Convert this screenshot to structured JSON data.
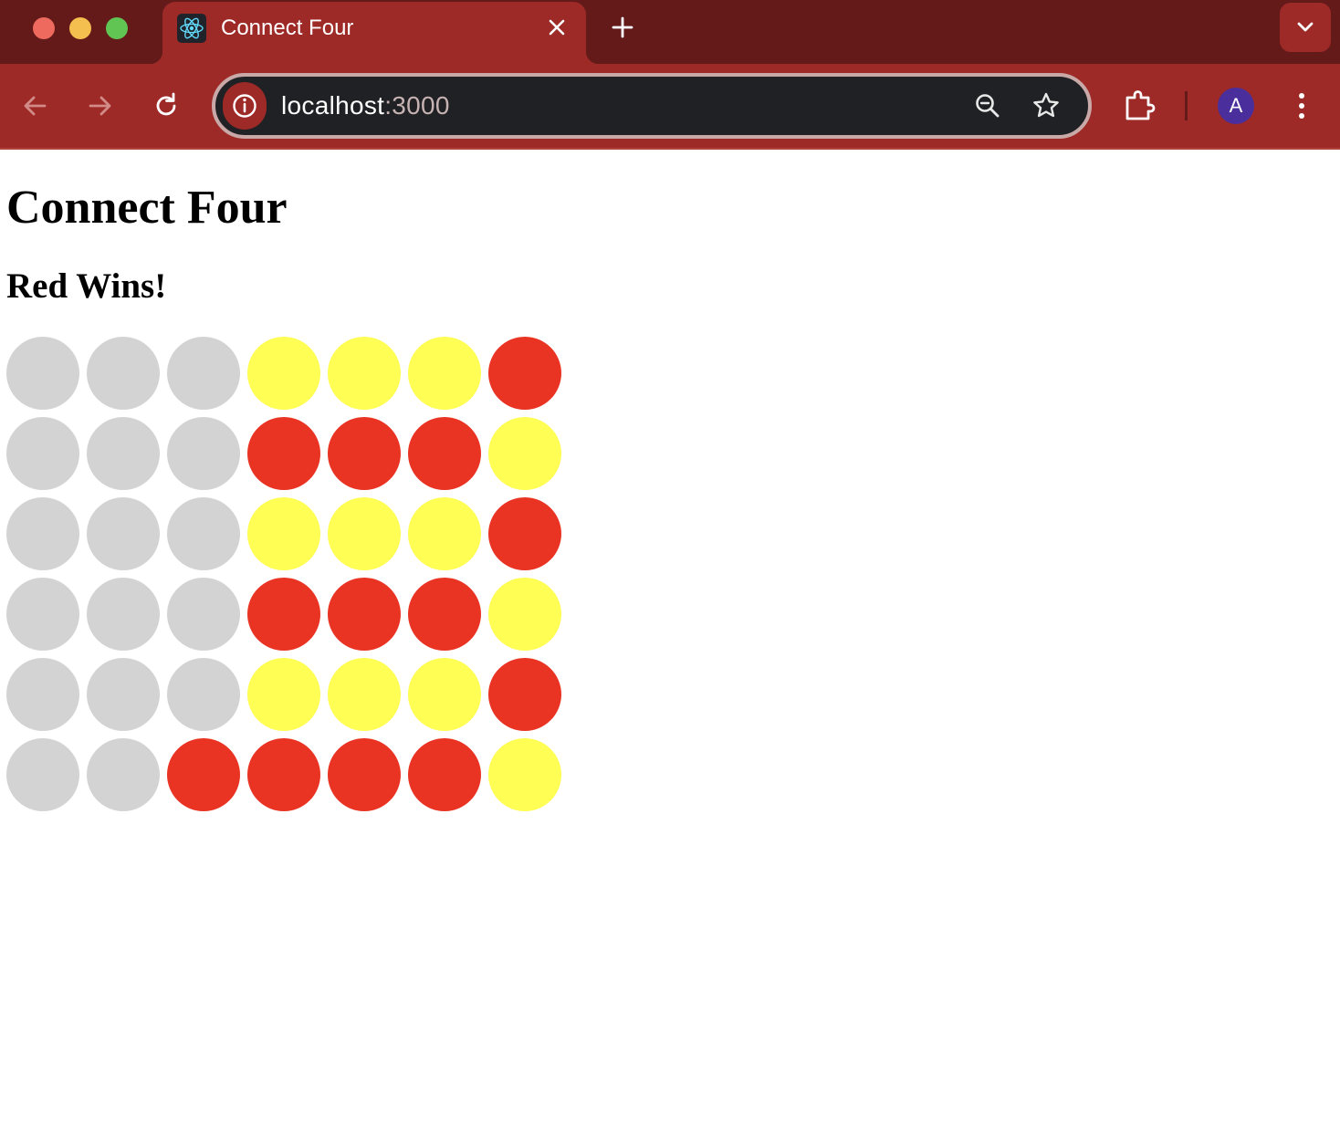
{
  "browser": {
    "tab": {
      "title": "Connect Four",
      "favicon": "react-logo-icon"
    },
    "url": {
      "host": "localhost",
      "port": ":3000"
    },
    "profile_initial": "A",
    "colors": {
      "tabstrip": "#651a1a",
      "toolbar": "#9d2a27",
      "omnibox": "#202124"
    }
  },
  "page": {
    "title": "Connect Four",
    "status": "Red Wins!"
  },
  "game": {
    "colors": {
      "empty": "#d3d3d3",
      "red": "#e93424",
      "yellow": "#fefe54"
    },
    "board": [
      [
        "empty",
        "empty",
        "empty",
        "yellow",
        "yellow",
        "yellow",
        "red"
      ],
      [
        "empty",
        "empty",
        "empty",
        "red",
        "red",
        "red",
        "yellow"
      ],
      [
        "empty",
        "empty",
        "empty",
        "yellow",
        "yellow",
        "yellow",
        "red"
      ],
      [
        "empty",
        "empty",
        "empty",
        "red",
        "red",
        "red",
        "yellow"
      ],
      [
        "empty",
        "empty",
        "empty",
        "yellow",
        "yellow",
        "yellow",
        "red"
      ],
      [
        "empty",
        "empty",
        "red",
        "red",
        "red",
        "red",
        "yellow"
      ]
    ]
  }
}
